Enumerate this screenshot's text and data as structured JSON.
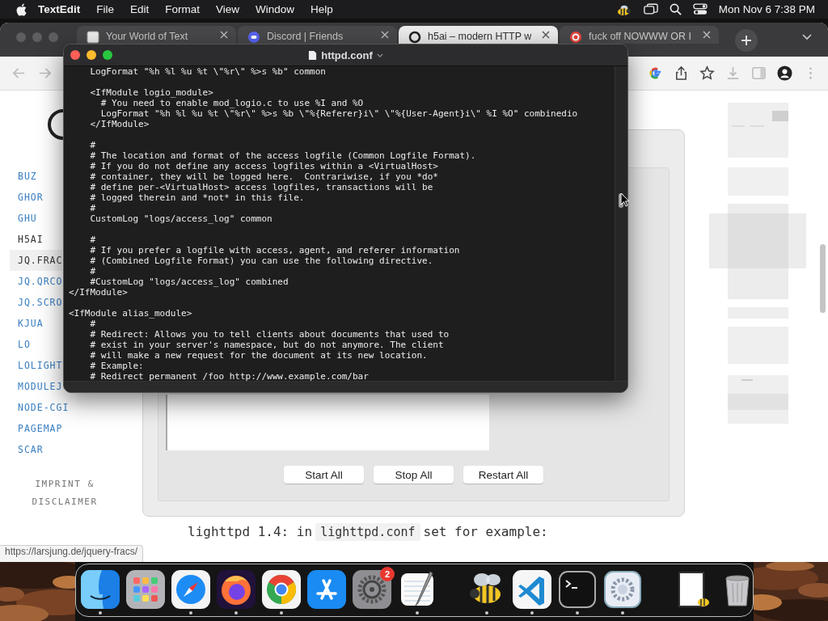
{
  "menubar": {
    "app": "TextEdit",
    "menus": [
      "File",
      "Edit",
      "Format",
      "View",
      "Window",
      "Help"
    ],
    "clock": "Mon Nov 6 7:38 PM"
  },
  "browser": {
    "tabs": [
      {
        "title": "Your World of Text",
        "kind": "square",
        "selected": false
      },
      {
        "title": "Discord | Friends",
        "kind": "blue-circle",
        "selected": false
      },
      {
        "title": "h5ai – modern HTTP w",
        "kind": "ring",
        "selected": true
      },
      {
        "title": "fuck off NOWWW OR I",
        "kind": "red-circle",
        "selected": false
      }
    ]
  },
  "site": {
    "nav": [
      {
        "label": "BUZ",
        "current": false,
        "hovered": false
      },
      {
        "label": "GHOR",
        "current": false,
        "hovered": false
      },
      {
        "label": "GHU",
        "current": false,
        "hovered": false
      },
      {
        "label": "H5AI",
        "current": true,
        "hovered": false
      },
      {
        "label": "JQ.FRAC",
        "current": false,
        "hovered": true
      },
      {
        "label": "JQ.QRCO",
        "current": false,
        "hovered": false
      },
      {
        "label": "JQ.SCRO",
        "current": false,
        "hovered": false
      },
      {
        "label": "KJUA",
        "current": false,
        "hovered": false
      },
      {
        "label": "LO",
        "current": false,
        "hovered": false
      },
      {
        "label": "LOLIGHT",
        "current": false,
        "hovered": false
      },
      {
        "label": "MODULEJ",
        "current": false,
        "hovered": false
      },
      {
        "label": "NODE-CGI",
        "current": false,
        "hovered": false
      },
      {
        "label": "PAGEMAP",
        "current": false,
        "hovered": false
      },
      {
        "label": "SCAR",
        "current": false,
        "hovered": false
      }
    ],
    "footer_link": "IMPRINT & DISCLAIMER",
    "buttons": [
      "Start All",
      "Stop All",
      "Restart All"
    ],
    "intro": [
      {
        "kind": "text",
        "text": "lighttpd 1.4: in"
      },
      {
        "kind": "code",
        "text": "lighttpd.conf"
      },
      {
        "kind": "text",
        "text": "set for example:"
      }
    ],
    "status_url": "https://larsjung.de/jquery-fracs/"
  },
  "editor": {
    "title": "httpd.conf",
    "blocks": [
      [
        "    LogFormat \"%h %l %u %t \\\"%r\\\" %>s %b\" common"
      ],
      [
        "    <IfModule logio_module>",
        "      # You need to enable mod_logio.c to use %I and %O",
        "      LogFormat \"%h %l %u %t \\\"%r\\\" %>s %b \\\"%{Referer}i\\\" \\\"%{User-Agent}i\\\" %I %O\" combinedio",
        "    </IfModule>"
      ],
      [
        "    #",
        "    # The location and format of the access logfile (Common Logfile Format).",
        "    # If you do not define any access logfiles within a <VirtualHost>",
        "    # container, they will be logged here.  Contrariwise, if you *do*",
        "    # define per-<VirtualHost> access logfiles, transactions will be",
        "    # logged therein and *not* in this file.",
        "    #",
        "    CustomLog \"logs/access_log\" common"
      ],
      [
        "    #",
        "    # If you prefer a logfile with access, agent, and referer information",
        "    # (Combined Logfile Format) you can use the following directive.",
        "    #",
        "    #CustomLog \"logs/access_log\" combined",
        "</IfModule>"
      ],
      [
        "<IfModule alias_module>",
        "    #",
        "    # Redirect: Allows you to tell clients about documents that used to",
        "    # exist in your server's namespace, but do not anymore. The client",
        "    # will make a new request for the document at its new location.",
        "    # Example:",
        "    # Redirect permanent /foo http://www.example.com/bar"
      ]
    ]
  },
  "dock": {
    "items": [
      {
        "kind": "finder",
        "running": true
      },
      {
        "kind": "launchpad",
        "running": false
      },
      {
        "kind": "safari",
        "running": true
      },
      {
        "kind": "firefox",
        "running": true
      },
      {
        "kind": "chrome",
        "running": true
      },
      {
        "kind": "appstore",
        "running": false
      },
      {
        "kind": "settings",
        "running": false,
        "badge": "2"
      },
      {
        "kind": "textedit",
        "running": true
      },
      {
        "kind": "separator"
      },
      {
        "kind": "bee",
        "running": true
      },
      {
        "kind": "vscode",
        "running": true
      },
      {
        "kind": "terminal",
        "running": true
      },
      {
        "kind": "gearapp",
        "running": true
      },
      {
        "kind": "separator"
      },
      {
        "kind": "document",
        "running": false
      },
      {
        "kind": "trash",
        "running": false
      }
    ]
  }
}
